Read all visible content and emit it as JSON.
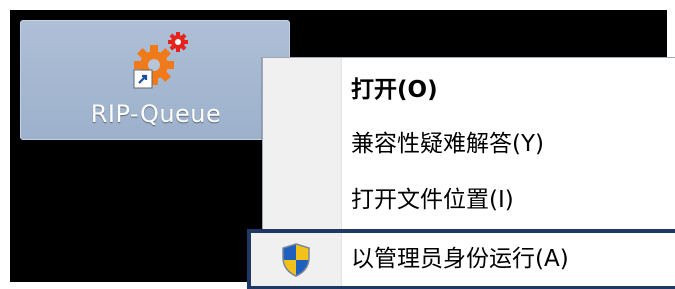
{
  "desktop": {
    "shortcut": {
      "label": "RIP-Queue",
      "icon": "gear-shortcut-icon"
    }
  },
  "context_menu": {
    "items": [
      {
        "label": "打开(O)",
        "bold": true
      },
      {
        "label": "兼容性疑难解答(Y)",
        "bold": false
      },
      {
        "label": "打开文件位置(I)",
        "bold": false
      },
      {
        "label": "以管理员身份运行(A)",
        "bold": false,
        "icon": "uac-shield-icon",
        "highlighted": true
      }
    ]
  },
  "colors": {
    "desktop_background": "#000000",
    "shortcut_selection": "#a6b8d1",
    "menu_gutter": "#f0f0f0",
    "highlight_border": "#1f3864",
    "gear_orange": "#f07a1a",
    "gear_red": "#e5231b"
  }
}
